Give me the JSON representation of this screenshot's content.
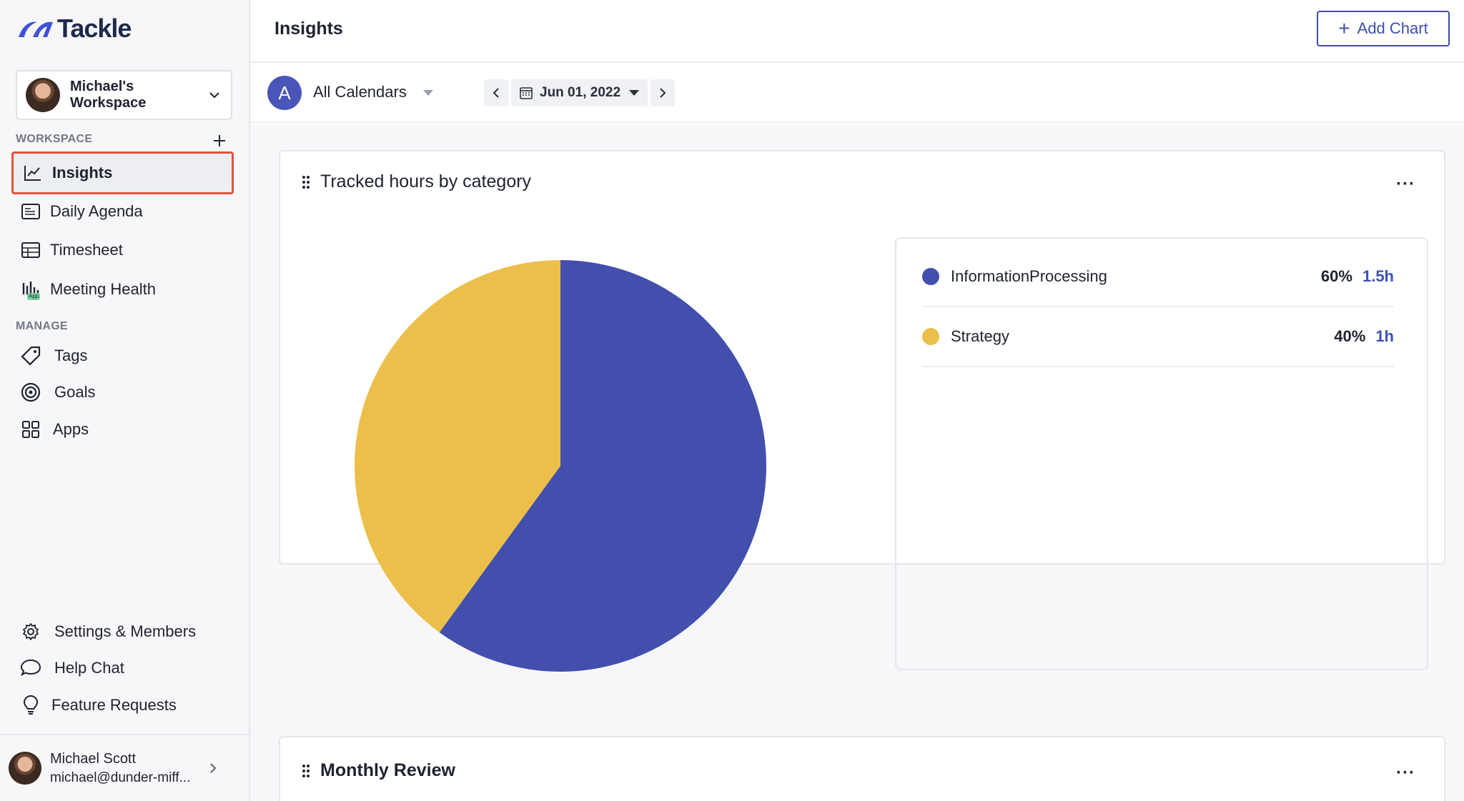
{
  "app": {
    "logo_text": "Tackle"
  },
  "workspace_switcher": {
    "name": "Michael's Workspace"
  },
  "sidebar": {
    "workspace_label": "WORKSPACE",
    "manage_label": "MANAGE",
    "workspace_items": [
      {
        "label": "Insights",
        "icon": "chart-line-icon"
      },
      {
        "label": "Daily Agenda",
        "icon": "agenda-icon"
      },
      {
        "label": "Timesheet",
        "icon": "table-icon"
      },
      {
        "label": "Meeting Health",
        "icon": "bar-chart-icon"
      }
    ],
    "manage_items": [
      {
        "label": "Tags",
        "icon": "tag-icon"
      },
      {
        "label": "Goals",
        "icon": "target-icon"
      },
      {
        "label": "Apps",
        "icon": "apps-grid-icon"
      }
    ],
    "footer_items": [
      {
        "label": "Settings & Members",
        "icon": "gear-icon"
      },
      {
        "label": "Help Chat",
        "icon": "chat-icon"
      },
      {
        "label": "Feature Requests",
        "icon": "lightbulb-icon"
      }
    ],
    "app_badge": "App"
  },
  "user": {
    "name": "Michael Scott",
    "email": "michael@dunder-miff..."
  },
  "header": {
    "title": "Insights",
    "add_chart_label": "Add Chart"
  },
  "filters": {
    "calendar_initial": "A",
    "calendar_name": "All Calendars",
    "date": "Jun 01, 2022"
  },
  "cards": {
    "tracked": {
      "title": "Tracked hours by category"
    },
    "monthly": {
      "title": "Monthly Review"
    }
  },
  "chart_data": {
    "type": "pie",
    "title": "Tracked hours by category",
    "categories": [
      "InformationProcessing",
      "Strategy"
    ],
    "values": [
      60,
      40
    ],
    "hours": [
      "1.5h",
      "1h"
    ],
    "percent_labels": [
      "60%",
      "40%"
    ],
    "colors": [
      "#434fad",
      "#ecbf4b"
    ],
    "legend_placement": "right"
  },
  "colors": {
    "accent": "#3e4eab",
    "active_outline": "#e0543a"
  }
}
